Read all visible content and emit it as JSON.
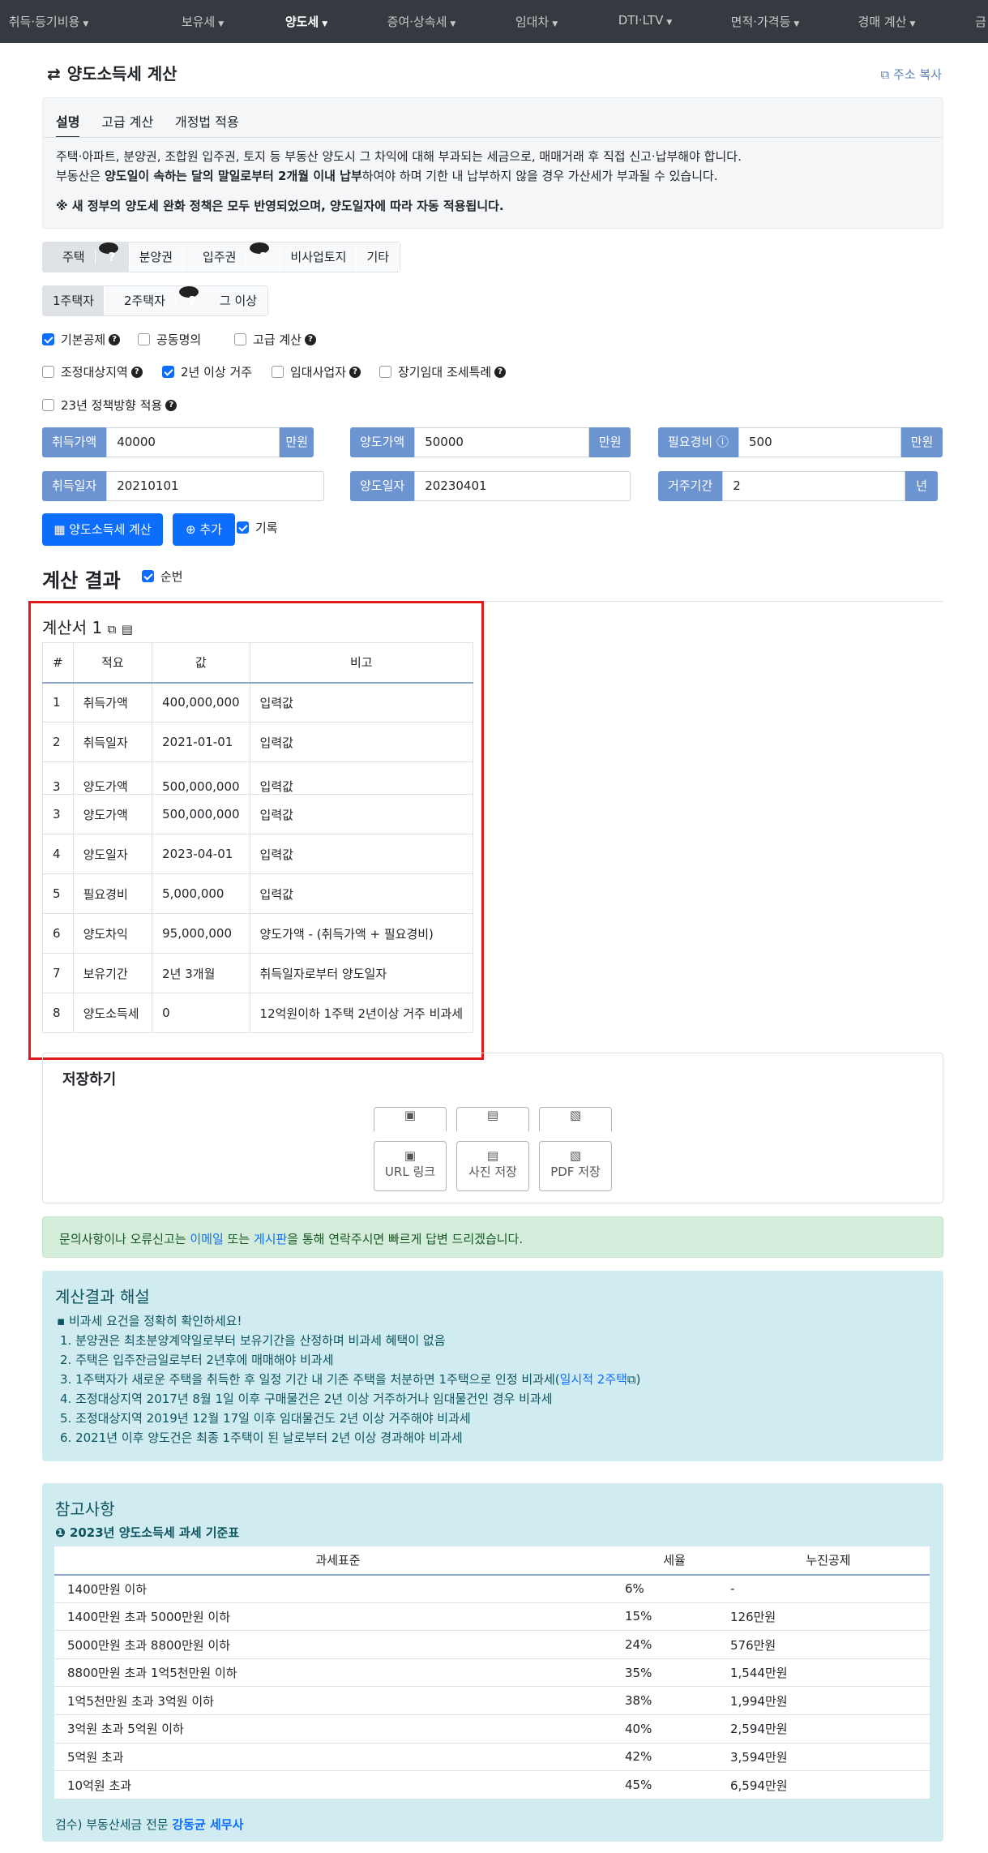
{
  "nav": [
    "취득·등기비용",
    "보유세",
    "양도세",
    "증여·상속세",
    "임대차",
    "DTI·LTV",
    "면적·가격등",
    "경매 계산",
    "금"
  ],
  "page_title": "양도소득세 계산",
  "copy_address": "주소 복사",
  "info": {
    "tabs": [
      "설명",
      "고급 계산",
      "개정법 적용"
    ],
    "line1": "주택·아파트, 분양권, 조합원 입주권, 토지 등 부동산 양도시 그 차익에 대해 부과되는 세금으로, 매매거래 후 직접 신고·납부해야 합니다.",
    "line2_a": "부동산은 ",
    "line2_b": "양도일이 속하는 달의 말일로부터 2개월 이내 납부",
    "line2_c": "하여야 하며 기한 내 납부하지 않을 경우 가산세가 부과될 수 있습니다.",
    "note": "※ 새 정부의 양도세 완화 정책은 모두 반영되었으며, 양도일자에 따라 자동 적용됩니다."
  },
  "types": [
    "주택",
    "분양권",
    "입주권",
    "비사업토지",
    "기타"
  ],
  "owners": [
    "1주택자",
    "2주택자",
    "그 이상"
  ],
  "checks": {
    "basic": "기본공제",
    "joint": "공동명의",
    "advanced": "고급 계산",
    "adjusted": "조정대상지역",
    "twoyear": "2년 이상 거주",
    "rental": "임대사업자",
    "longrent": "장기임대 조세특례",
    "policy23": "23년 정책방향 적용"
  },
  "inputs": {
    "acq_price_label": "취득가액",
    "acq_price": "40000",
    "unit_man": "만원",
    "sale_price_label": "양도가액",
    "sale_price": "50000",
    "expense_label": "필요경비",
    "expense": "500",
    "acq_date_label": "취득일자",
    "acq_date": "20210101",
    "sale_date_label": "양도일자",
    "sale_date": "20230401",
    "residence_label": "거주기간",
    "residence": "2",
    "unit_year": "년"
  },
  "buttons": {
    "calc": "양도소득세 계산",
    "add": "추가",
    "record": "기록"
  },
  "result_title": "계산 결과",
  "order_label": "순번",
  "statement": "계산서 1",
  "result_headers": [
    "#",
    "적요",
    "값",
    "비고"
  ],
  "result_rows": [
    [
      "1",
      "취득가액",
      "400,000,000",
      "입력값"
    ],
    [
      "2",
      "취득일자",
      "2021-01-01",
      "입력값"
    ],
    [
      "3",
      "양도가액",
      "500,000,000",
      "입력값"
    ],
    [
      "3",
      "양도가액",
      "500,000,000",
      "입력값"
    ],
    [
      "4",
      "양도일자",
      "2023-04-01",
      "입력값"
    ],
    [
      "5",
      "필요경비",
      "5,000,000",
      "입력값"
    ],
    [
      "6",
      "양도차익",
      "95,000,000",
      "양도가액 - (취득가액 + 필요경비)"
    ],
    [
      "7",
      "보유기간",
      "2년 3개월",
      "취득일자로부터 양도일자"
    ],
    [
      "8",
      "양도소득세",
      "0",
      "12억원이하 1주택 2년이상 거주 비과세"
    ]
  ],
  "save": {
    "title": "저장하기",
    "url": "URL 링크",
    "photo": "사진 저장",
    "pdf": "PDF 저장"
  },
  "contact": {
    "a": "문의사항이나 오류신고는 ",
    "email": "이메일",
    "b": " 또는 ",
    "board": "게시판",
    "c": "을 통해 연락주시면 빠르게 답변 드리겠습니다."
  },
  "explain": {
    "title": "계산결과 해설",
    "head": "비과세 요건을 정확히 확인하세요!",
    "items": [
      "1. 분양권은 최초분양계약일로부터 보유기간을 산정하며 비과세 혜택이 없음",
      "2. 주택은 입주잔금일로부터 2년후에 매매해야 비과세",
      "3. 1주택자가 새로운 주택을 취득한 후 일정 기간 내 기존 주택을 처분하면 1주택으로 인정 비과세(",
      "4. 조정대상지역 2017년 8월 1일 이후 구매물건은 2년 이상 거주하거나 임대물건인 경우 비과세",
      "5. 조정대상지역 2019년 12월 17일 이후 임대물건도 2년 이상 거주해야 비과세",
      "6. 2021년 이후 양도건은 최종 1주택이 된 날로부터 2년 이상 경과해야 비과세"
    ],
    "link": "일시적 2주택",
    "close": ")"
  },
  "reference": {
    "title": "참고사항",
    "subtitle": "2023년 양도소득세 과세 기준표",
    "headers": [
      "과세표준",
      "세율",
      "누진공제"
    ],
    "rows": [
      [
        "1400만원 이하",
        "6%",
        "-"
      ],
      [
        "1400만원 초과 5000만원 이하",
        "15%",
        "126만원"
      ],
      [
        "5000만원 초과 8800만원 이하",
        "24%",
        "576만원"
      ],
      [
        "8800만원 초과 1억5천만원 이하",
        "35%",
        "1,544만원"
      ],
      [
        "1억5천만원 초과 3억원 이하",
        "38%",
        "1,994만원"
      ],
      [
        "3억원 초과 5억원 이하",
        "40%",
        "2,594만원"
      ],
      [
        "5억원 초과",
        "42%",
        "3,594만원"
      ],
      [
        "10억원 초과",
        "45%",
        "6,594만원"
      ]
    ],
    "footer_a": "검수) 부동산세금 전문 ",
    "footer_b": "강동균 세무사"
  }
}
